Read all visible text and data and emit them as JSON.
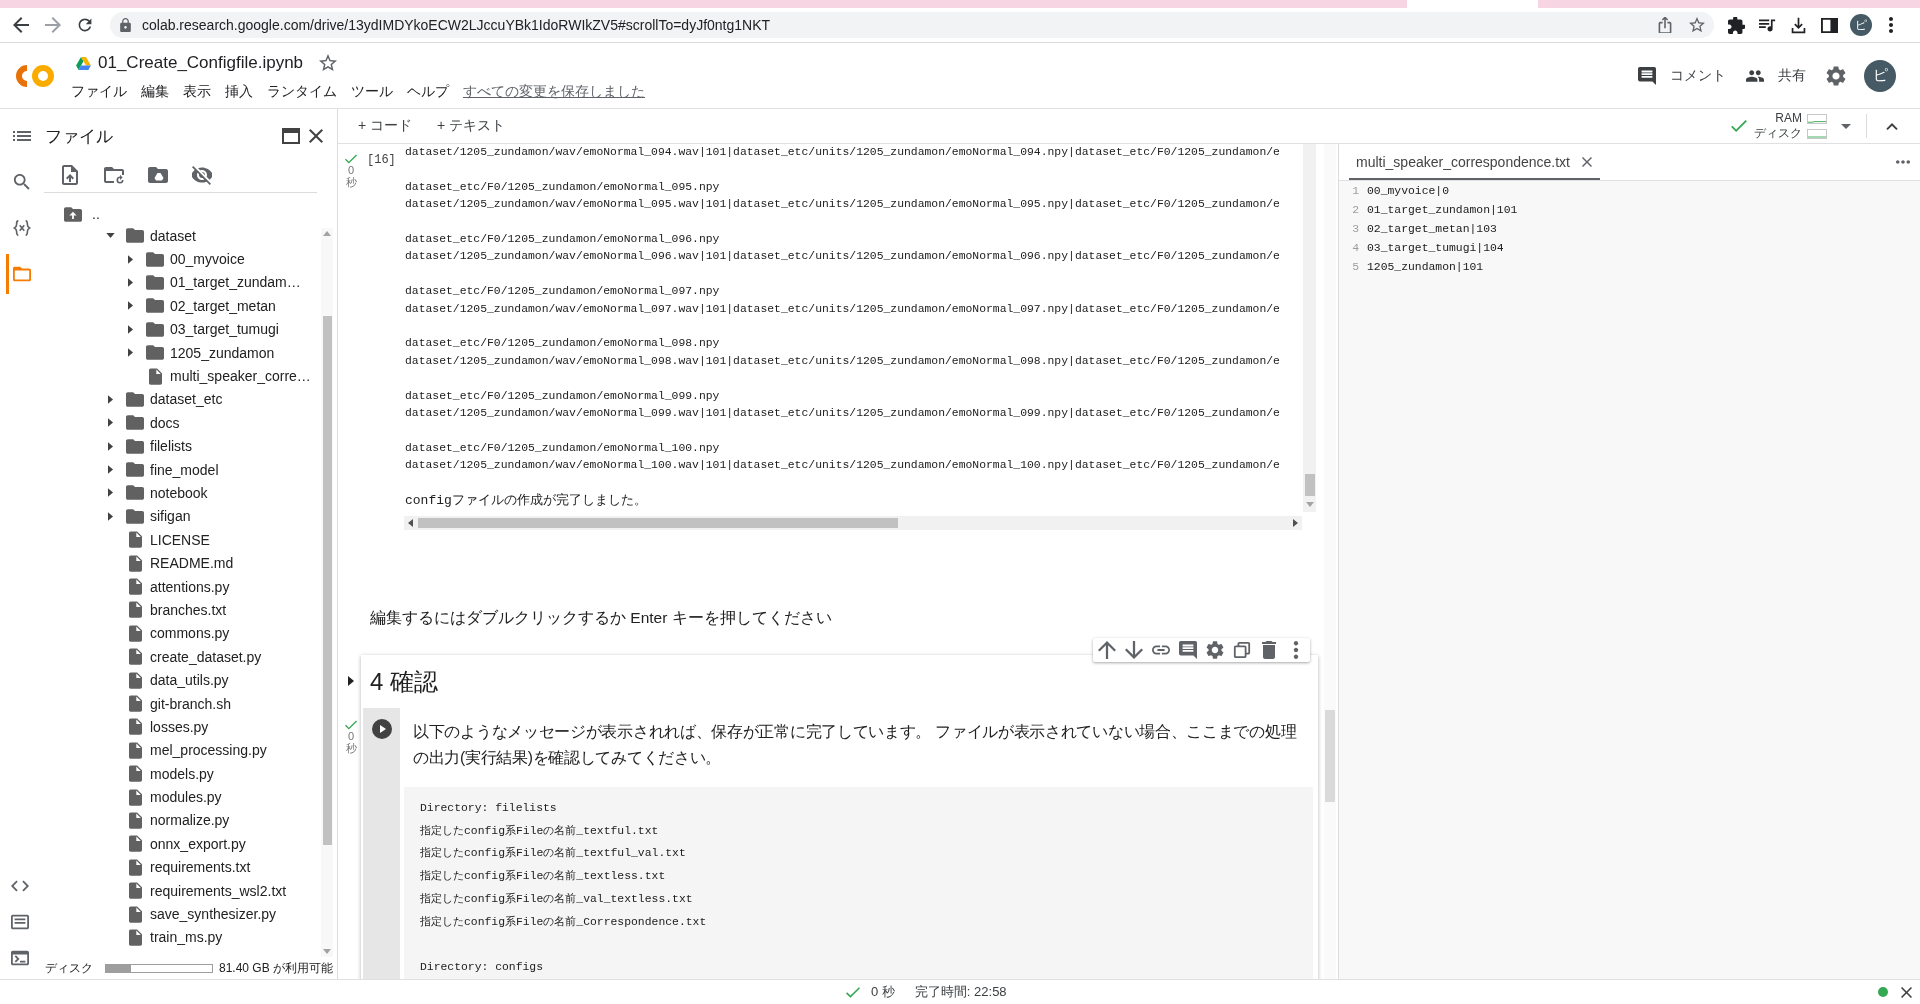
{
  "browser": {
    "url": "colab.research.google.com/drive/13ydIMDYkoECW2LJccuYBk1IdoRWIkZV5#scrollTo=dyJf0ntg1NKT",
    "forward_disabled": true,
    "profile_initial": "ピ"
  },
  "header": {
    "title": "01_Create_Configfile.ipynb",
    "starred": false,
    "menu": [
      "ファイル",
      "編集",
      "表示",
      "挿入",
      "ランタイム",
      "ツール",
      "ヘルプ"
    ],
    "save_status": "すべての変更を保存しました",
    "actions": [
      {
        "kind": "comment",
        "label": "コメント"
      },
      {
        "kind": "share",
        "label": "共有"
      },
      {
        "kind": "settings"
      }
    ],
    "avatar_initial": "ピ"
  },
  "activity_bar": {
    "top": [
      {
        "kind": "toc",
        "selected": false
      },
      {
        "kind": "search",
        "selected": false
      },
      {
        "kind": "variables",
        "selected": false
      },
      {
        "kind": "files",
        "selected": true
      }
    ],
    "bottom": [
      {
        "kind": "code"
      },
      {
        "kind": "command"
      },
      {
        "kind": "terminal"
      }
    ]
  },
  "file_panel": {
    "title": "ファイル",
    "tools": [
      {
        "kind": "upload"
      },
      {
        "kind": "refresh"
      },
      {
        "kind": "drive"
      },
      {
        "kind": "hide"
      }
    ],
    "tree": [
      {
        "name": "..",
        "kind": "parent"
      },
      {
        "name": "dataset",
        "kind": "folder",
        "expanded": true,
        "children": [
          {
            "name": "00_myvoice",
            "kind": "folder",
            "expanded": false
          },
          {
            "name": "01_target_zundam…",
            "kind": "folder",
            "expanded": false
          },
          {
            "name": "02_target_metan",
            "kind": "folder",
            "expanded": false
          },
          {
            "name": "03_target_tumugi",
            "kind": "folder",
            "expanded": false
          },
          {
            "name": "1205_zundamon",
            "kind": "folder",
            "expanded": false
          },
          {
            "name": "multi_speaker_corre…",
            "kind": "file"
          }
        ]
      },
      {
        "name": "dataset_etc",
        "kind": "folder",
        "expanded": false
      },
      {
        "name": "docs",
        "kind": "folder",
        "expanded": false
      },
      {
        "name": "filelists",
        "kind": "folder",
        "expanded": false
      },
      {
        "name": "fine_model",
        "kind": "folder",
        "expanded": false
      },
      {
        "name": "notebook",
        "kind": "folder",
        "expanded": false
      },
      {
        "name": "sifigan",
        "kind": "folder",
        "expanded": false
      },
      {
        "name": "LICENSE",
        "kind": "file"
      },
      {
        "name": "README.md",
        "kind": "file"
      },
      {
        "name": "attentions.py",
        "kind": "file"
      },
      {
        "name": "branches.txt",
        "kind": "file"
      },
      {
        "name": "commons.py",
        "kind": "file"
      },
      {
        "name": "create_dataset.py",
        "kind": "file"
      },
      {
        "name": "data_utils.py",
        "kind": "file"
      },
      {
        "name": "git-branch.sh",
        "kind": "file"
      },
      {
        "name": "losses.py",
        "kind": "file"
      },
      {
        "name": "mel_processing.py",
        "kind": "file"
      },
      {
        "name": "models.py",
        "kind": "file"
      },
      {
        "name": "modules.py",
        "kind": "file"
      },
      {
        "name": "normalize.py",
        "kind": "file"
      },
      {
        "name": "onnx_export.py",
        "kind": "file"
      },
      {
        "name": "requirements.txt",
        "kind": "file"
      },
      {
        "name": "requirements_wsl2.txt",
        "kind": "file"
      },
      {
        "name": "save_synthesizer.py",
        "kind": "file"
      },
      {
        "name": "train_ms.py",
        "kind": "file"
      }
    ],
    "disk": {
      "label": "ディスク",
      "level": 0.24,
      "reading": "81.40 GB が利用可能"
    }
  },
  "notebook_toolbar": {
    "add_buttons": [
      "+ コード",
      "+ テキスト"
    ],
    "resources": {
      "connected": true,
      "ram": {
        "label": "RAM"
      },
      "disk": {
        "label": "ディスク"
      }
    }
  },
  "output_cell": {
    "done": true,
    "execution_count": "[16]",
    "time": "0",
    "time_unit": "秒",
    "output": [
      {
        "lines": [
          "dataset/1205_zundamon/wav/emoNormal_094.wav|101|dataset_etc/units/1205_zundamon/emoNormal_094.npy|dataset_etc/F0/1205_zundamon/e"
        ]
      },
      {
        "lines": [
          "dataset_etc/F0/1205_zundamon/emoNormal_095.npy",
          "dataset/1205_zundamon/wav/emoNormal_095.wav|101|dataset_etc/units/1205_zundamon/emoNormal_095.npy|dataset_etc/F0/1205_zundamon/e"
        ]
      },
      {
        "lines": [
          "dataset_etc/F0/1205_zundamon/emoNormal_096.npy",
          "dataset/1205_zundamon/wav/emoNormal_096.wav|101|dataset_etc/units/1205_zundamon/emoNormal_096.npy|dataset_etc/F0/1205_zundamon/e"
        ]
      },
      {
        "lines": [
          "dataset_etc/F0/1205_zundamon/emoNormal_097.npy",
          "dataset/1205_zundamon/wav/emoNormal_097.wav|101|dataset_etc/units/1205_zundamon/emoNormal_097.npy|dataset_etc/F0/1205_zundamon/e"
        ]
      },
      {
        "lines": [
          "dataset_etc/F0/1205_zundamon/emoNormal_098.npy",
          "dataset/1205_zundamon/wav/emoNormal_098.wav|101|dataset_etc/units/1205_zundamon/emoNormal_098.npy|dataset_etc/F0/1205_zundamon/e"
        ]
      },
      {
        "lines": [
          "dataset_etc/F0/1205_zundamon/emoNormal_099.npy",
          "dataset/1205_zundamon/wav/emoNormal_099.wav|101|dataset_etc/units/1205_zundamon/emoNormal_099.npy|dataset_etc/F0/1205_zundamon/e"
        ]
      },
      {
        "lines": [
          "dataset_etc/F0/1205_zundamon/emoNormal_100.npy",
          "dataset/1205_zundamon/wav/emoNormal_100.wav|101|dataset_etc/units/1205_zundamon/emoNormal_100.npy|dataset_etc/F0/1205_zundamon/e"
        ]
      },
      {
        "lines": [
          "configファイルの作成が完了しました。"
        ]
      }
    ]
  },
  "text_cell": {
    "hint": "編集するにはダブルクリックするか Enter キーを押してください"
  },
  "cell_toolbar": [
    {
      "kind": "up"
    },
    {
      "kind": "down"
    },
    {
      "kind": "link"
    },
    {
      "kind": "comment"
    },
    {
      "kind": "settings"
    },
    {
      "kind": "mirror"
    },
    {
      "kind": "delete"
    },
    {
      "kind": "more"
    }
  ],
  "section": {
    "heading": "4 確認",
    "code_cell": {
      "done": true,
      "time": "0",
      "time_unit": "秒",
      "description": "以下のようなメッセージが表示されれば、保存が正常に完了しています。 ファイルが表示されていない場合、ここまでの処理の出力(実行結果)を確認してみてください。",
      "code": [
        {
          "lines": [
            "Directory: filelists",
            "指定したconfig系Fileの名前_textful.txt",
            "指定したconfig系Fileの名前_textful_val.txt",
            "指定したconfig系Fileの名前_textless.txt",
            "指定したconfig系Fileの名前_val_textless.txt",
            "指定したconfig系Fileの名前_Correspondence.txt"
          ]
        },
        {
          "lines": [
            "Directory: configs"
          ]
        }
      ]
    }
  },
  "editor": {
    "tabs": [
      {
        "label": "multi_speaker_correspondence.txt",
        "selected": true
      }
    ],
    "lines": [
      {
        "number": "1",
        "text": "00_myvoice|0"
      },
      {
        "number": "2",
        "text": "01_target_zundamon|101"
      },
      {
        "number": "3",
        "text": "02_target_metan|103"
      },
      {
        "number": "4",
        "text": "03_target_tumugi|104"
      },
      {
        "number": "5",
        "text": "1205_zundamon|101"
      }
    ]
  },
  "status_bar": {
    "done": true,
    "duration": "0 秒",
    "finished": "完了時間: 22:58",
    "connected": true
  }
}
